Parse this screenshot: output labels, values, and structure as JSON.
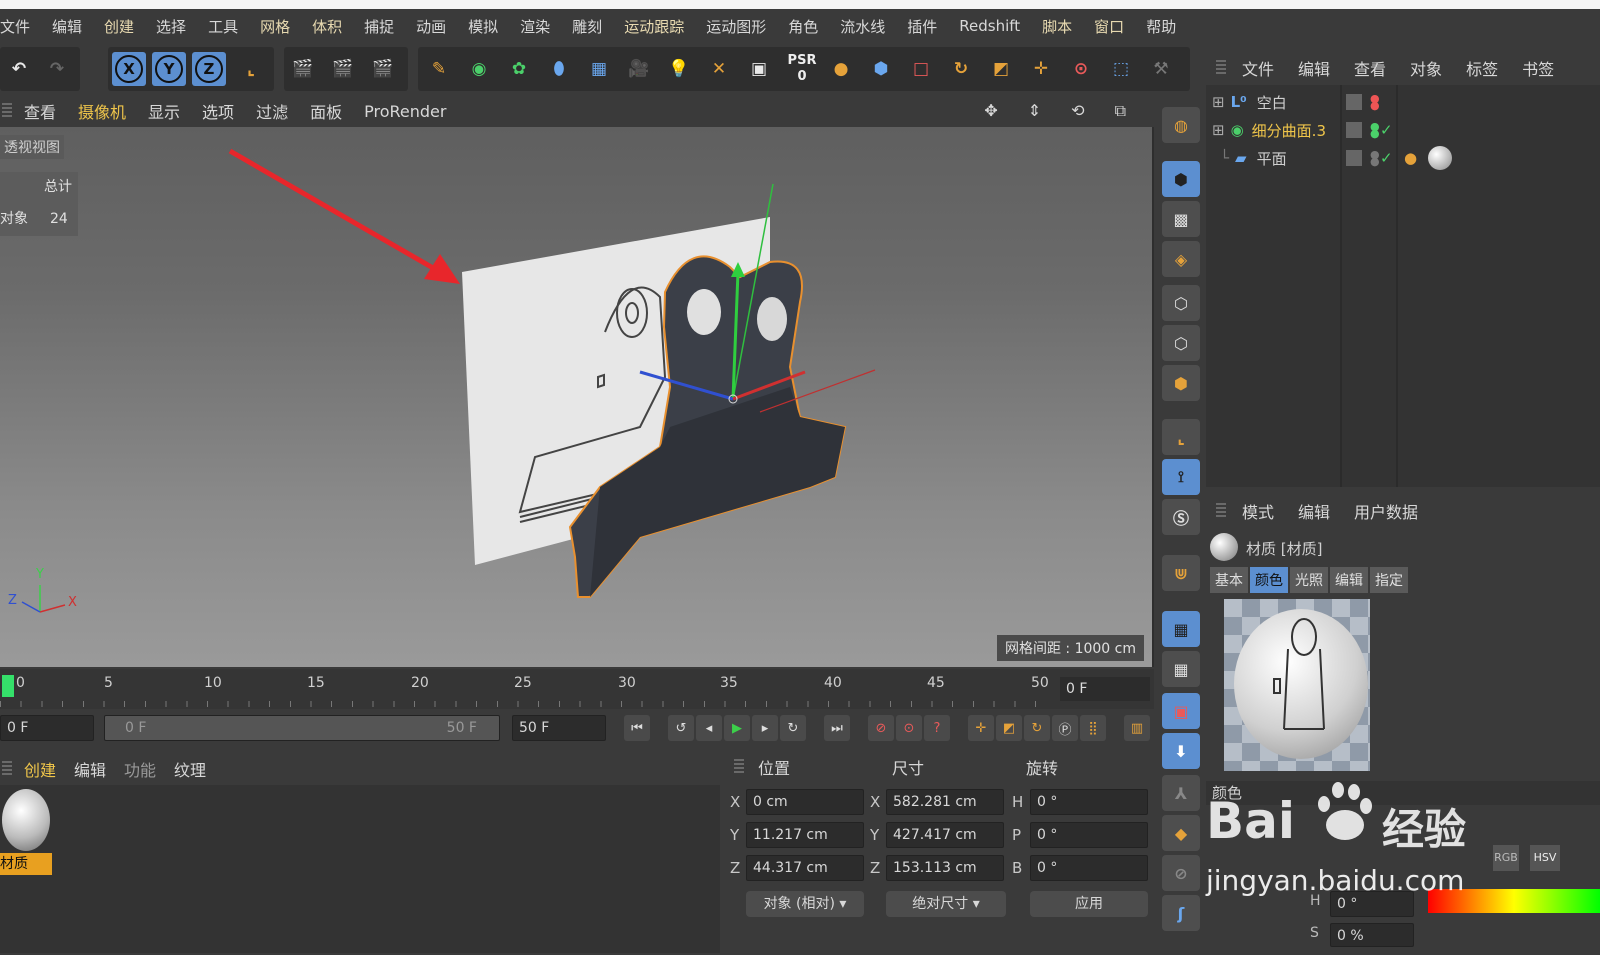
{
  "menubar": [
    "文件",
    "编辑",
    "创建",
    "选择",
    "工具",
    "网格",
    "体积",
    "捕捉",
    "动画",
    "模拟",
    "渲染",
    "雕刻",
    "运动跟踪",
    "运动图形",
    "角色",
    "流水线",
    "插件",
    "Redshift",
    "脚本",
    "窗口",
    "帮助"
  ],
  "toolbar": {
    "axis_x": "X",
    "axis_y": "Y",
    "axis_z": "Z",
    "psr_label": "PSR",
    "psr_value": "0"
  },
  "viewport_menu": [
    "查看",
    "摄像机",
    "显示",
    "选项",
    "过滤",
    "面板",
    "ProRender"
  ],
  "viewport": {
    "view_name": "透视视图",
    "stats_total_label": "总计",
    "stats_objects_label": "对象",
    "stats_objects_value": "24",
    "grid_spacing": "网格间距 : 1000 cm",
    "axis_y": "Y",
    "axis_z": "Z",
    "axis_x": "X"
  },
  "object_manager": {
    "menu": [
      "文件",
      "编辑",
      "查看",
      "对象",
      "标签",
      "书签"
    ],
    "objects": [
      {
        "name": "空白",
        "icon": "null-icon"
      },
      {
        "name": "细分曲面.3",
        "icon": "subdivision-icon"
      },
      {
        "name": "平面",
        "icon": "plane-icon"
      }
    ]
  },
  "attribute_manager": {
    "menu": [
      "模式",
      "编辑",
      "用户数据"
    ],
    "title": "材质 [材质]",
    "tabs": [
      "基本",
      "颜色",
      "光照",
      "编辑",
      "指定"
    ],
    "section": "颜色",
    "h_label": "H",
    "h_value": "0 °",
    "s_label": "S",
    "s_value": "0 %",
    "mode_rgb": "RGB",
    "mode_hsv": "HSV"
  },
  "timeline": {
    "ticks": [
      "0",
      "5",
      "10",
      "15",
      "20",
      "25",
      "30",
      "35",
      "40",
      "45",
      "50"
    ],
    "current_frame": "0 F"
  },
  "playbar": {
    "start_field": "0 F",
    "range_start": "0 F",
    "range_end": "50 F",
    "end_field": "50 F"
  },
  "material_manager": {
    "menu": [
      "创建",
      "编辑",
      "功能",
      "纹理"
    ],
    "material_name": "材质"
  },
  "coordinates": {
    "headers": {
      "position": "位置",
      "size": "尺寸",
      "rotation": "旋转"
    },
    "rows": [
      {
        "axis": "X",
        "pos": "0 cm",
        "size_axis": "X",
        "size": "582.281 cm",
        "rot_axis": "H",
        "rot": "0 °"
      },
      {
        "axis": "Y",
        "pos": "11.217 cm",
        "size_axis": "Y",
        "size": "427.417 cm",
        "rot_axis": "P",
        "rot": "0 °"
      },
      {
        "axis": "Z",
        "pos": "44.317 cm",
        "size_axis": "Z",
        "size": "153.113 cm",
        "rot_axis": "B",
        "rot": "0 °"
      }
    ],
    "mode_dropdown": "对象 (相对)",
    "size_dropdown": "绝对尺寸",
    "apply_button": "应用"
  },
  "watermark": {
    "brand": "Bai",
    "brand_cn": "经验",
    "url": "jingyan.baidu.com"
  },
  "colors": {
    "accent_blue": "#5c8fd0",
    "menu_highlight": "#efc54a",
    "arrow_red": "#e8262b",
    "selection_orange": "#e8902f"
  }
}
